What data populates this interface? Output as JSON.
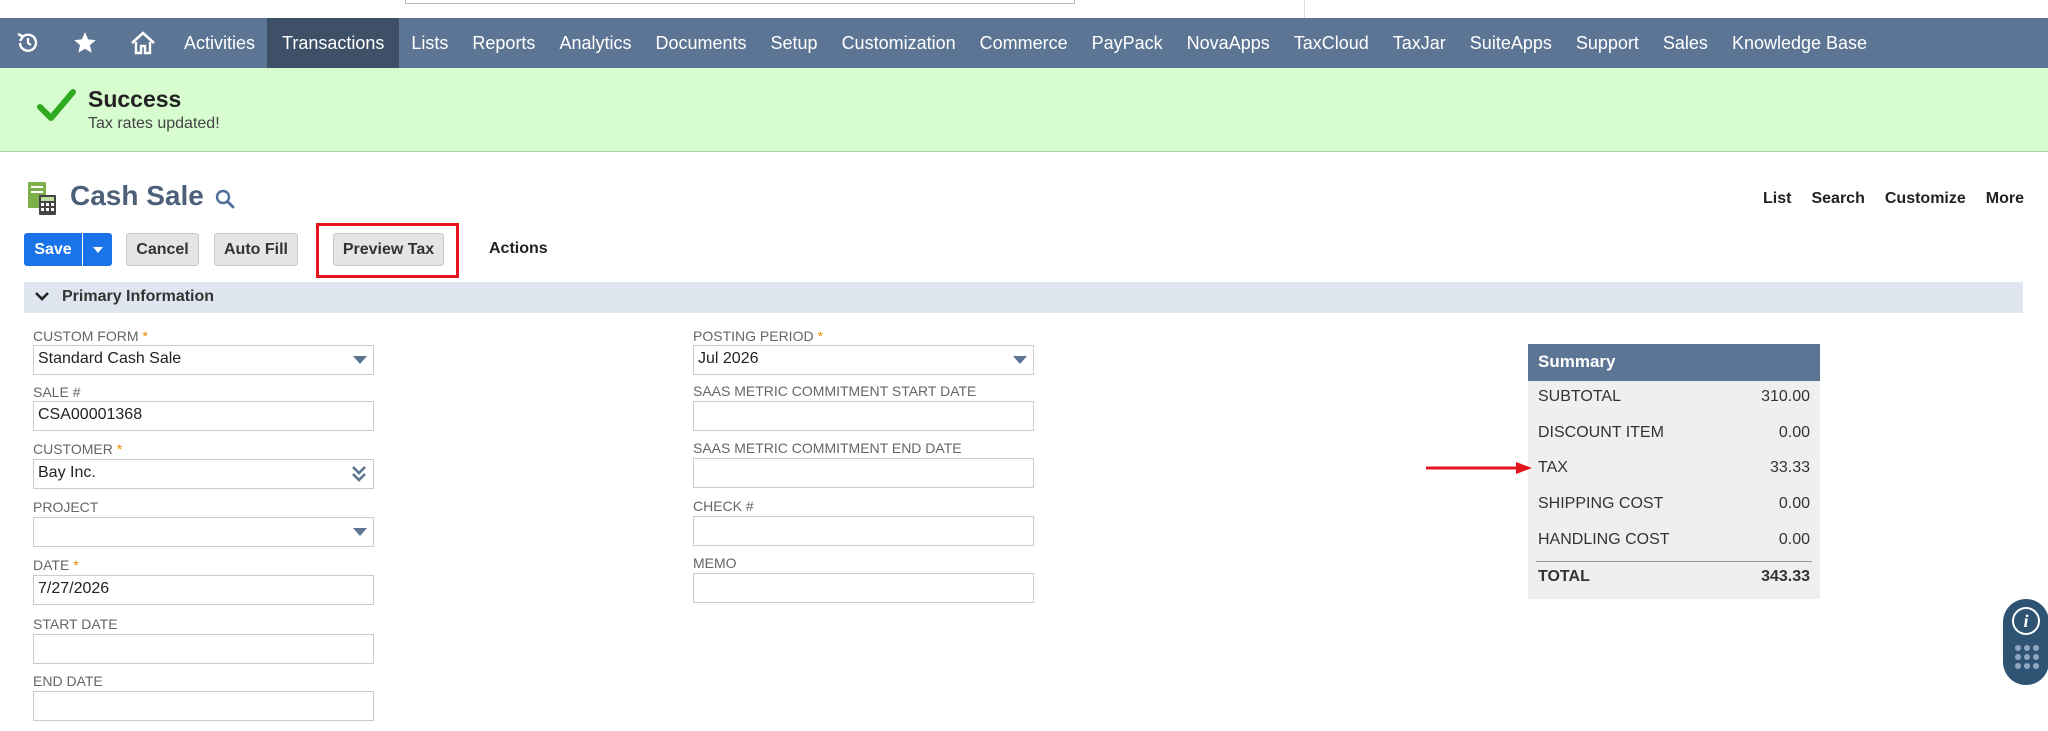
{
  "nav": {
    "items": [
      {
        "label": "Activities",
        "active": false
      },
      {
        "label": "Transactions",
        "active": true
      },
      {
        "label": "Lists",
        "active": false
      },
      {
        "label": "Reports",
        "active": false
      },
      {
        "label": "Analytics",
        "active": false
      },
      {
        "label": "Documents",
        "active": false
      },
      {
        "label": "Setup",
        "active": false
      },
      {
        "label": "Customization",
        "active": false
      },
      {
        "label": "Commerce",
        "active": false
      },
      {
        "label": "PayPack",
        "active": false
      },
      {
        "label": "NovaApps",
        "active": false
      },
      {
        "label": "TaxCloud",
        "active": false
      },
      {
        "label": "TaxJar",
        "active": false
      },
      {
        "label": "SuiteApps",
        "active": false
      },
      {
        "label": "Support",
        "active": false
      },
      {
        "label": "Sales",
        "active": false
      },
      {
        "label": "Knowledge Base",
        "active": false
      }
    ],
    "background": "#5d7594",
    "active_background": "#3e5068"
  },
  "banner": {
    "title": "Success",
    "message": "Tax rates updated!",
    "background": "#d7fcd0"
  },
  "page": {
    "title": "Cash Sale",
    "links": [
      "List",
      "Search",
      "Customize",
      "More"
    ]
  },
  "toolbar": {
    "save_label": "Save",
    "cancel_label": "Cancel",
    "autofill_label": "Auto Fill",
    "preview_tax_label": "Preview Tax",
    "actions_label": "Actions"
  },
  "section": {
    "title": "Primary Information"
  },
  "form": {
    "custom_form": {
      "label": "CUSTOM FORM",
      "value": "Standard Cash Sale"
    },
    "sale_no": {
      "label": "SALE #",
      "value": "CSA00001368"
    },
    "customer": {
      "label": "CUSTOMER",
      "value": "Bay Inc."
    },
    "project": {
      "label": "PROJECT",
      "value": ""
    },
    "date": {
      "label": "DATE",
      "value": "7/27/2026"
    },
    "start_date": {
      "label": "START DATE",
      "value": ""
    },
    "end_date": {
      "label": "END DATE",
      "value": ""
    },
    "posting_period": {
      "label": "POSTING PERIOD",
      "value": "Jul 2026"
    },
    "saas_start": {
      "label": "SAAS METRIC COMMITMENT START DATE",
      "value": ""
    },
    "saas_end": {
      "label": "SAAS METRIC COMMITMENT END DATE",
      "value": ""
    },
    "check_no": {
      "label": "CHECK #",
      "value": ""
    },
    "memo": {
      "label": "MEMO",
      "value": ""
    },
    "required_marker": "*"
  },
  "summary": {
    "title": "Summary",
    "rows": [
      {
        "label": "SUBTOTAL",
        "value": "310.00"
      },
      {
        "label": "DISCOUNT ITEM",
        "value": "0.00"
      },
      {
        "label": "TAX",
        "value": "33.33"
      },
      {
        "label": "SHIPPING COST",
        "value": "0.00"
      },
      {
        "label": "HANDLING COST",
        "value": "0.00"
      }
    ],
    "total": {
      "label": "TOTAL",
      "value": "343.33"
    }
  },
  "colors": {
    "primary_button": "#1a73e8",
    "highlight": "#e6141c",
    "required": "#e88a00"
  }
}
